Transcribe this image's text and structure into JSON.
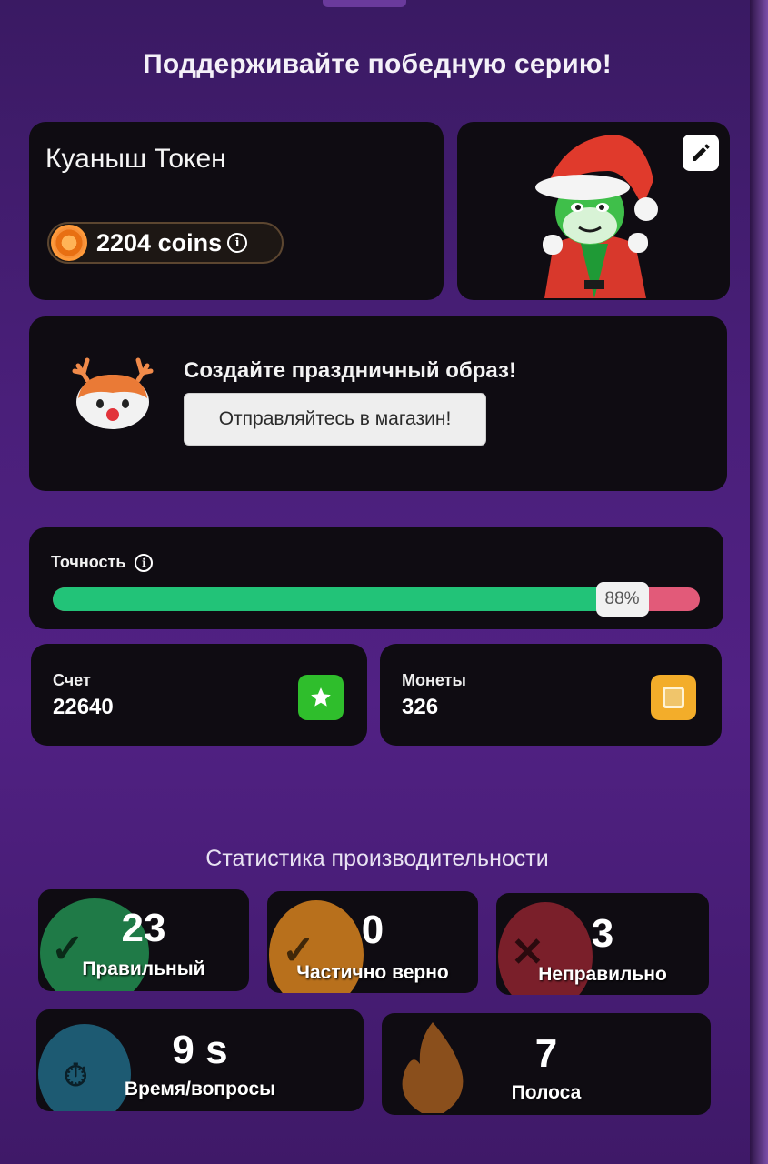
{
  "headline": "Поддерживайте победную серию!",
  "profile": {
    "name": "Куаныш Токен",
    "coins_text": "2204 coins"
  },
  "promo": {
    "title": "Создайте праздничный образ!",
    "button_label": "Отправляйтесь в магазин!"
  },
  "accuracy": {
    "label": "Точность",
    "percent_text": "88%",
    "percent": 88
  },
  "score": {
    "label": "Счет",
    "value": "22640"
  },
  "coins": {
    "label": "Монеты",
    "value": "326"
  },
  "performance": {
    "title": "Статистика производительности",
    "stats": [
      {
        "value": "23",
        "label": "Правильный",
        "color": "#1f7a47",
        "icon": "check-icon"
      },
      {
        "value": "0",
        "label": "Частично верно",
        "color": "#b8701c",
        "icon": "check-icon"
      },
      {
        "value": "3",
        "label": "Неправильно",
        "color": "#7a1f2a",
        "icon": "cross-icon"
      },
      {
        "value": "9 s",
        "label": "Время/вопросы",
        "color": "#1d5a72",
        "icon": "stopwatch-icon"
      },
      {
        "value": "7",
        "label": "Полоса",
        "color": "#8a4f1c",
        "icon": "flame-icon"
      }
    ]
  },
  "colors": {
    "correct_fill": "#22c378",
    "incorrect_fill": "#e25a79",
    "star_box": "#2fbe2c",
    "coin_box": "#f3ad2a"
  }
}
